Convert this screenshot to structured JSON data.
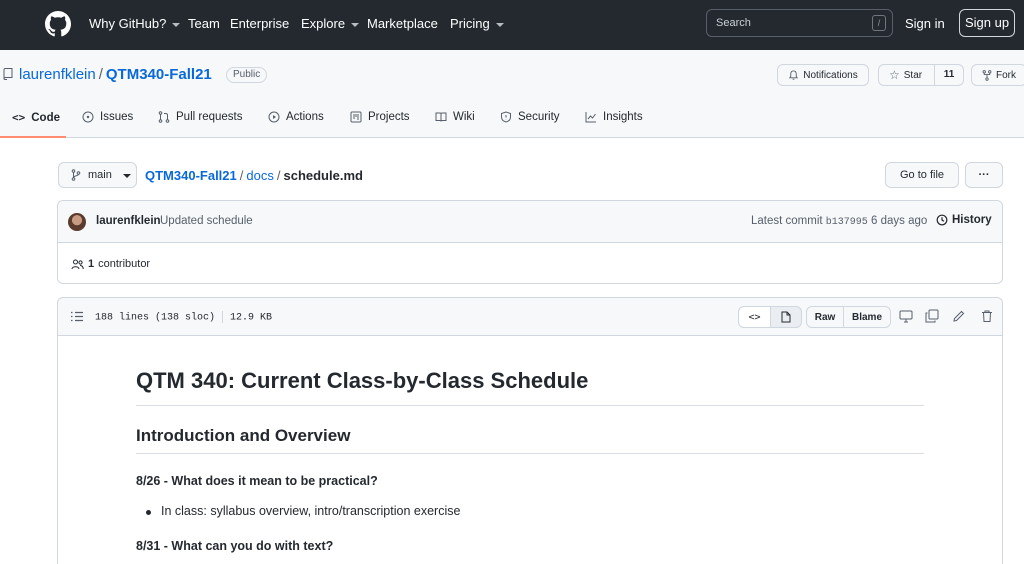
{
  "header": {
    "nav": [
      "Why GitHub?",
      "Team",
      "Enterprise",
      "Explore",
      "Marketplace",
      "Pricing"
    ],
    "search_placeholder": "Search",
    "search_key": "/",
    "signin": "Sign in",
    "signup": "Sign up"
  },
  "repo": {
    "owner": "laurenfklein",
    "separator": "/",
    "name": "QTM340-Fall21",
    "visibility": "Public",
    "notifications": "Notifications",
    "star": "Star",
    "star_count": "11",
    "fork": "Fork"
  },
  "tabs": [
    "Code",
    "Issues",
    "Pull requests",
    "Actions",
    "Projects",
    "Wiki",
    "Security",
    "Insights"
  ],
  "file_nav": {
    "branch": "main",
    "path": [
      "QTM340-Fall21",
      "docs"
    ],
    "file": "schedule.md",
    "go_to_file": "Go to file",
    "more": "···"
  },
  "commit": {
    "author": "laurenfklein",
    "message": "Updated schedule",
    "latest_label": "Latest commit",
    "sha": "b137995",
    "age": "6 days ago",
    "history": "History",
    "contributors": "1",
    "contributors_label": "contributor"
  },
  "file": {
    "lines": "188 lines (138 sloc)",
    "size": "12.9 KB",
    "raw": "Raw",
    "blame": "Blame"
  },
  "content": {
    "title": "QTM 340: Current Class-by-Class Schedule",
    "section": "Introduction and Overview",
    "item1_heading": "8/26 - What does it mean to be practical?",
    "item1_bullet": "In class: syllabus overview, intro/transcription exercise",
    "item2_heading": "8/31 - What can you do with text?"
  },
  "colors": {
    "header_bg": "#24292f",
    "link": "#0969da",
    "tab_active_underline": "#fd8c73"
  }
}
